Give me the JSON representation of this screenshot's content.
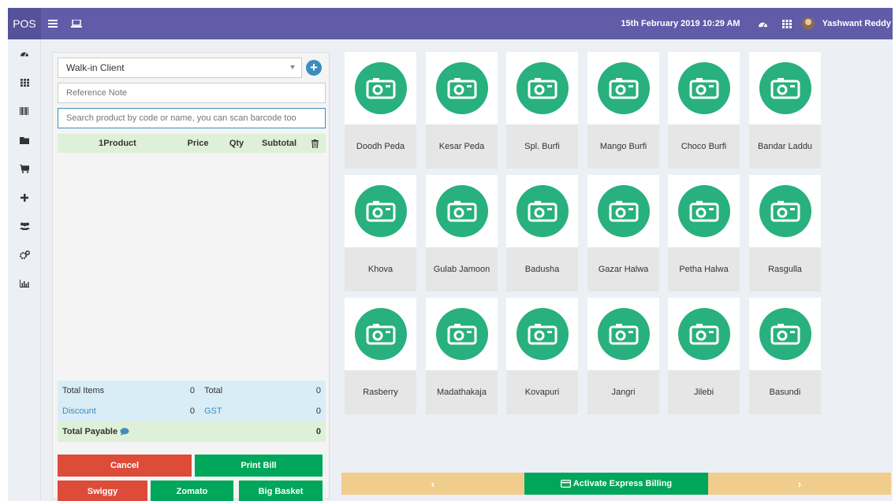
{
  "header": {
    "logo": "POS",
    "datetime": "15th February 2019 10:29 AM",
    "user_name": "Yashwant Reddy"
  },
  "sidebar": {
    "icons": [
      "dashboard-icon",
      "grid-icon",
      "barcode-icon",
      "folder-icon",
      "cart-icon",
      "plus-icon",
      "users-icon",
      "cogs-icon",
      "bar-chart-icon"
    ]
  },
  "order": {
    "client": "Walk-in Client",
    "reference_placeholder": "Reference Note",
    "search_placeholder": "Search product by code or name, you can scan barcode too",
    "columns": {
      "product": "1Product",
      "price": "Price",
      "qty": "Qty",
      "subtotal": "Subtotal"
    }
  },
  "totals": {
    "total_items_label": "Total Items",
    "total_items": "0",
    "total_label": "Total",
    "total": "0",
    "discount_label": "Discount",
    "discount": "0",
    "gst_label": "GST",
    "gst": "0",
    "payable_label": "Total Payable",
    "payable": "0"
  },
  "buttons": {
    "cancel": "Cancel",
    "print_bill": "Print Bill",
    "swiggy": "Swiggy",
    "zomato": "Zomato",
    "big_basket": "Big Basket"
  },
  "products": [
    "Doodh Peda",
    "Kesar Peda",
    "Spl. Burfi",
    "Mango Burfi",
    "Choco Burfi",
    "Bandar Laddu",
    "Khova",
    "Gulab Jamoon",
    "Badusha",
    "Gazar Halwa",
    "Petha Halwa",
    "Rasgulla",
    "Rasberry",
    "Madathakaja",
    "Kovapuri",
    "Jangri",
    "Jilebi",
    "Basundi"
  ],
  "bottom": {
    "prev": "‹",
    "express": "Activate Express Billing",
    "next": "›"
  },
  "colors": {
    "header": "#605ca8",
    "product_icon": "#28b07f",
    "danger": "#dd4b39",
    "success": "#00a65a",
    "nav_bar": "#f0cd8c"
  }
}
